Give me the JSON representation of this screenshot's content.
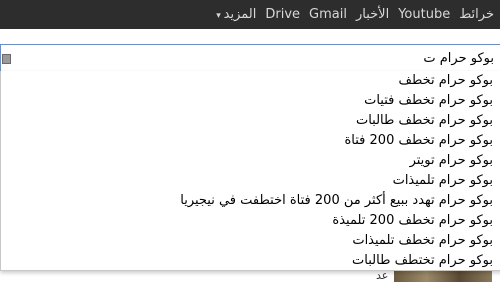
{
  "topbar": {
    "links": [
      {
        "label": "خرائط"
      },
      {
        "label": "Youtube"
      },
      {
        "label": "الأخبار"
      },
      {
        "label": "Gmail"
      },
      {
        "label": "Drive"
      },
      {
        "label": "المزيد"
      }
    ]
  },
  "search": {
    "value": "بوكو حرام ت"
  },
  "suggestions": [
    "بوكو حرام تخطف",
    "بوكو حرام تخطف فتيات",
    "بوكو حرام تخطف طالبات",
    "بوكو حرام تخطف 200 فتاة",
    "بوكو حرام تويتر",
    "بوكو حرام تلميذات",
    "بوكو حرام تهدد ببيع أكثر من 200 فتاة اختطفت في نيجيريا",
    "بوكو حرام تخطف 200 تلميذة",
    "بوكو حرام تخطف تلميذات",
    "بوكو حرام تختطف طالبات"
  ],
  "background": {
    "partial_text": "عد"
  }
}
